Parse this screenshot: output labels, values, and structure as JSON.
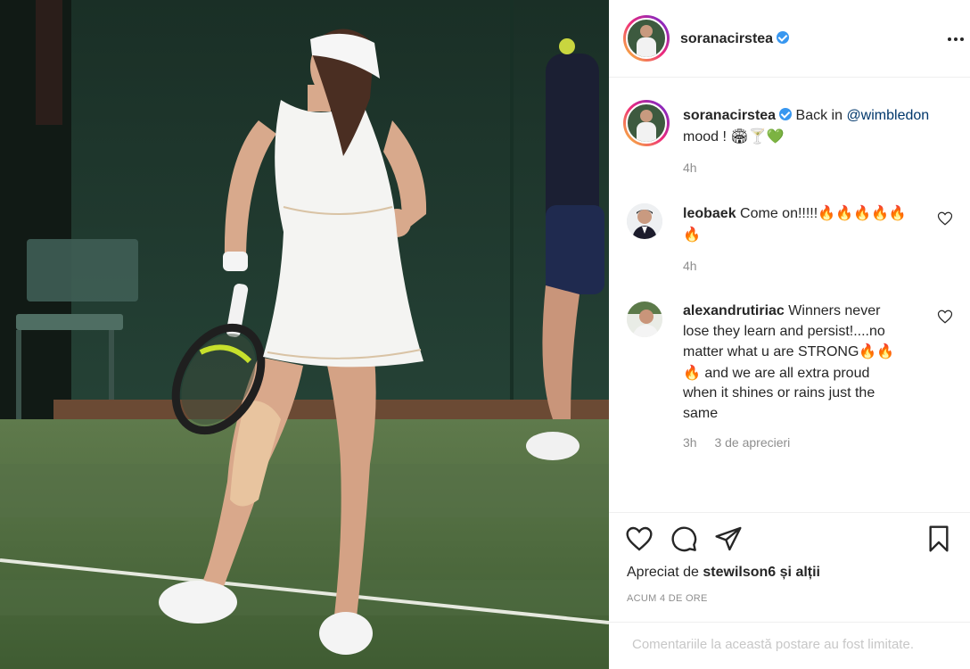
{
  "photo": {
    "description_icon": "tennis-player-photo",
    "colors": {
      "court": "#4a6b3a",
      "backdrop": "#1f3a2c",
      "dress": "#f4f4f2"
    }
  },
  "header": {
    "username": "soranacirstea",
    "verified": true,
    "more_icon": "more-horizontal-icon"
  },
  "caption": {
    "username": "soranacirstea",
    "text_before": "Back in ",
    "mention": "@wimbledon",
    "text_after": "mood ! ",
    "emojis": "🏟🍸💚",
    "time": "4h"
  },
  "comments": [
    {
      "username": "leobaek",
      "text": "Come on!!!!!",
      "emojis_line1": "🔥🔥🔥🔥🔥",
      "emojis_line2": "🔥",
      "time": "4h"
    },
    {
      "username": "alexandrutiriac",
      "text_line1": "Winners never",
      "text_line2": "lose they learn and persist!....no",
      "text_line3": "matter what u are STRONG",
      "emojis_line3": "🔥🔥",
      "text_line4": " and we are all extra proud",
      "emoji_line4": "🔥",
      "text_line5": "when it shines or rains just the",
      "text_line6": "same",
      "time": "3h",
      "likes": "3 de aprecieri"
    }
  ],
  "actions": {
    "like_icon": "heart-icon",
    "comment_icon": "comment-icon",
    "share_icon": "send-icon",
    "save_icon": "bookmark-icon"
  },
  "likes": {
    "prefix": "Apreciat de ",
    "user": "stewilson6",
    "suffix": " și alții"
  },
  "timestamp": "ACUM 4 DE ORE",
  "comments_limited": "Comentariile la această postare au fost limitate."
}
